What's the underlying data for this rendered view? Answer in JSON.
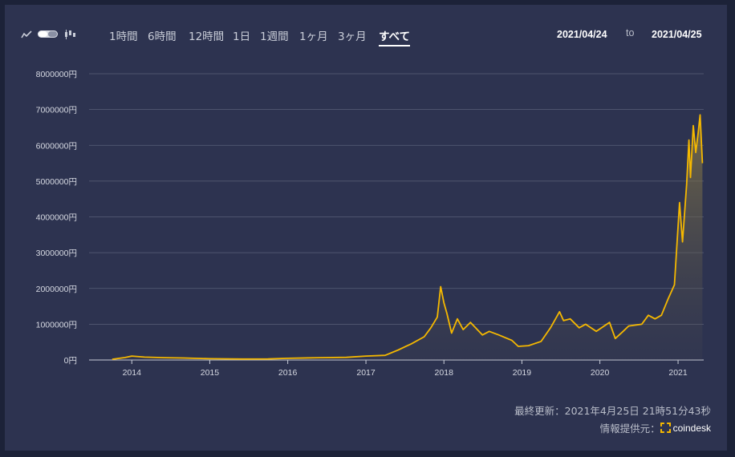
{
  "toolbar": {
    "tabs": [
      "1時間",
      "6時間",
      "12時間",
      "1日",
      "1週間",
      "1ヶ月",
      "3ヶ月",
      "すべて"
    ],
    "active_tab": "すべて",
    "date_from": "2021/04/24",
    "to_label": "to",
    "date_to": "2021/04/25",
    "icons": [
      "line-chart-icon",
      "toggle-switch",
      "candlestick-icon"
    ]
  },
  "footer": {
    "last_updated": "最終更新：2021年4月25日 21時51分43秒",
    "provider_label": "情報提供元：",
    "provider_name": "coindesk"
  },
  "colors": {
    "background": "#2d3350",
    "line": "#f5b800",
    "grid": "#5a6078",
    "text": "#c9cdd8"
  },
  "chart_data": {
    "type": "area",
    "y_unit": "円",
    "ylim": [
      0,
      8000000
    ],
    "yticks": [
      0,
      1000000,
      2000000,
      3000000,
      4000000,
      5000000,
      6000000,
      7000000,
      8000000
    ],
    "ytick_labels": [
      "0円",
      "1000000円",
      "2000000円",
      "3000000円",
      "4000000円",
      "5000000円",
      "6000000円",
      "7000000円",
      "8000000円"
    ],
    "xtick_labels": [
      "2014",
      "2015",
      "2016",
      "2017",
      "2018",
      "2019",
      "2020",
      "2021"
    ],
    "grid": true,
    "series": [
      {
        "x": [
          "2013-10",
          "2013-12",
          "2014-01",
          "2014-03",
          "2014-06",
          "2014-09",
          "2015-01",
          "2015-06",
          "2015-10",
          "2016-01",
          "2016-06",
          "2016-10",
          "2017-01",
          "2017-04",
          "2017-06",
          "2017-08",
          "2017-10",
          "2017-11",
          "2017-12-01",
          "2017-12-17",
          "2018-01-01",
          "2018-01-15",
          "2018-02-06",
          "2018-03-05",
          "2018-04-01",
          "2018-05-05",
          "2018-06-30",
          "2018-08-01",
          "2018-09-15",
          "2018-11-15",
          "2018-12-15",
          "2019-02-01",
          "2019-04-01",
          "2019-05-15",
          "2019-06-26",
          "2019-07-15",
          "2019-08-15",
          "2019-09-26",
          "2019-10-26",
          "2019-12-15",
          "2020-02-15",
          "2020-03-13",
          "2020-04-15",
          "2020-05-15",
          "2020-07-15",
          "2020-08-15",
          "2020-09-15",
          "2020-10-15",
          "2020-11-15",
          "2020-12-15",
          "2021-01-08",
          "2021-01-22",
          "2021-02-10",
          "2021-02-21",
          "2021-02-28",
          "2021-03-13",
          "2021-03-25",
          "2021-04-05",
          "2021-04-14",
          "2021-04-25"
        ],
        "y": [
          20000,
          70000,
          110000,
          80000,
          65000,
          55000,
          35000,
          28000,
          30000,
          48000,
          65000,
          75000,
          110000,
          130000,
          280000,
          450000,
          650000,
          900000,
          1200000,
          2050000,
          1600000,
          1300000,
          750000,
          1150000,
          850000,
          1050000,
          700000,
          800000,
          700000,
          550000,
          380000,
          400000,
          520000,
          900000,
          1350000,
          1100000,
          1150000,
          900000,
          1000000,
          800000,
          1050000,
          600000,
          780000,
          950000,
          1000000,
          1250000,
          1150000,
          1250000,
          1700000,
          2100000,
          4400000,
          3300000,
          4900000,
          6150000,
          5100000,
          6550000,
          5800000,
          6350000,
          6850000,
          5500000
        ]
      }
    ]
  }
}
